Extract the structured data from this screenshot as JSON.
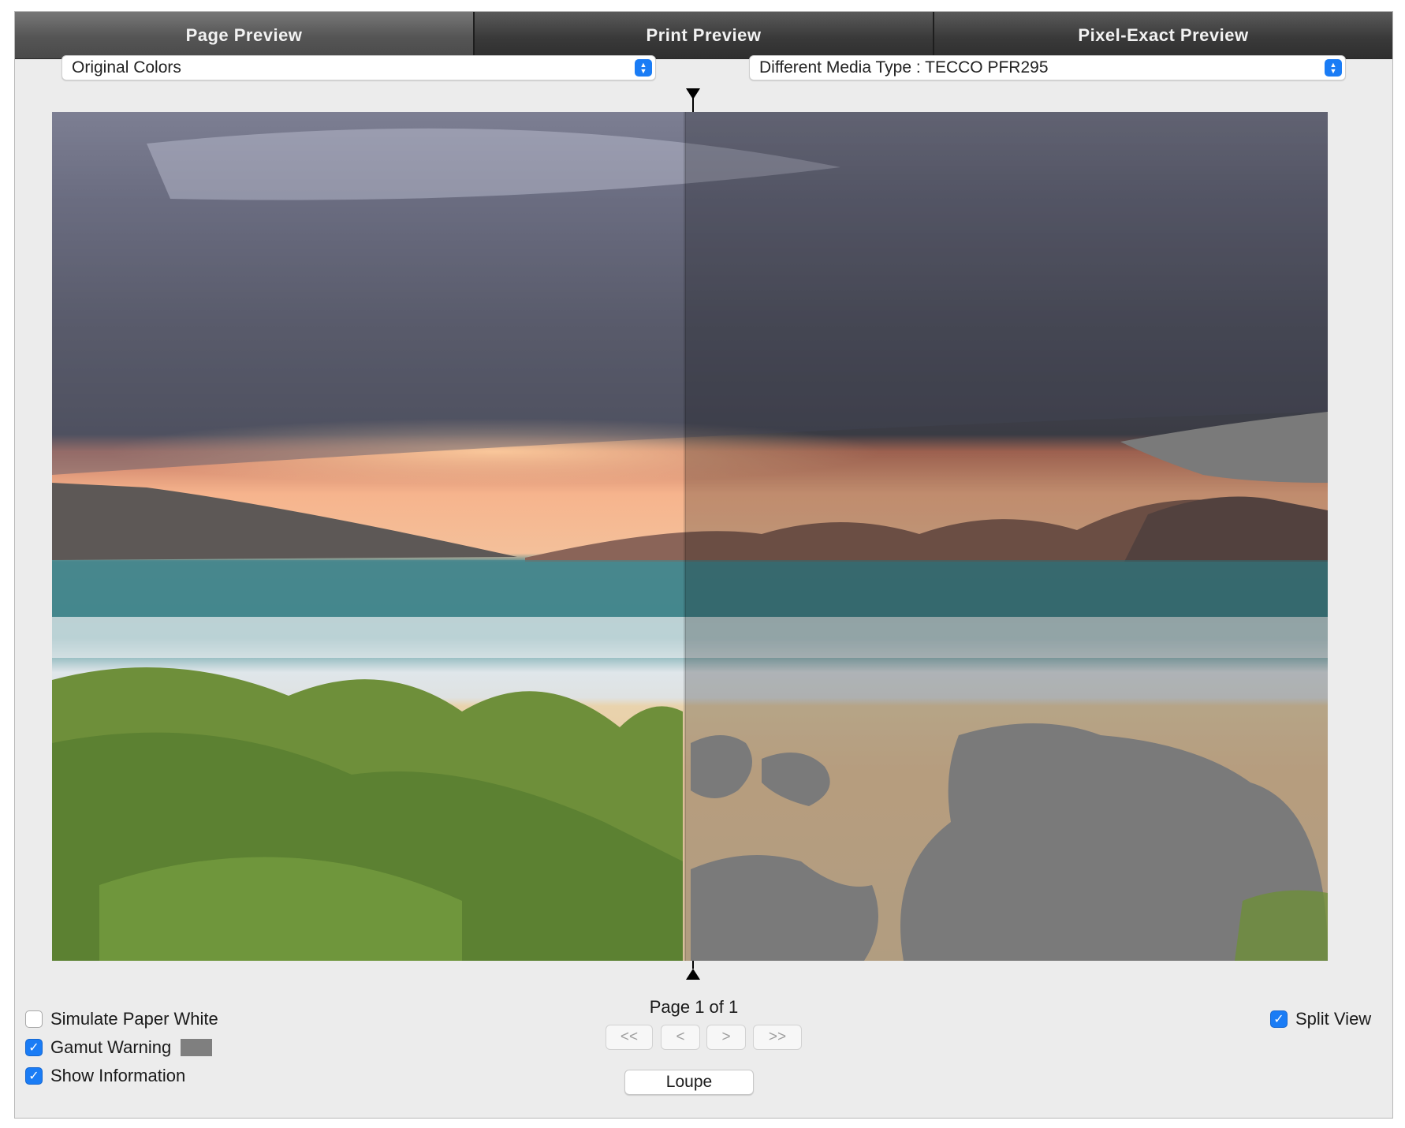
{
  "tabs": [
    {
      "label": "Page Preview",
      "active": true
    },
    {
      "label": "Print Preview",
      "active": false
    },
    {
      "label": "Pixel-Exact Preview",
      "active": false
    }
  ],
  "left_select": {
    "value": "Original Colors"
  },
  "right_select": {
    "value": "Different Media Type : TECCO PFR295"
  },
  "preview": {
    "split_view": true,
    "gamut_overlay_color": "#7a7a7a"
  },
  "options": {
    "simulate_paper_white": {
      "label": "Simulate Paper White",
      "checked": false
    },
    "gamut_warning": {
      "label": "Gamut Warning",
      "checked": true,
      "swatch_color": "#7f7f7f"
    },
    "show_information": {
      "label": "Show Information",
      "checked": true
    },
    "split_view": {
      "label": "Split View",
      "checked": true
    }
  },
  "pagination": {
    "label": "Page 1 of 1",
    "first": "<<",
    "prev": "<",
    "next": ">",
    "last": ">>"
  },
  "loupe_label": "Loupe",
  "icons": {
    "checkmark": "✓",
    "select_arrows": "up-down-chevron"
  }
}
